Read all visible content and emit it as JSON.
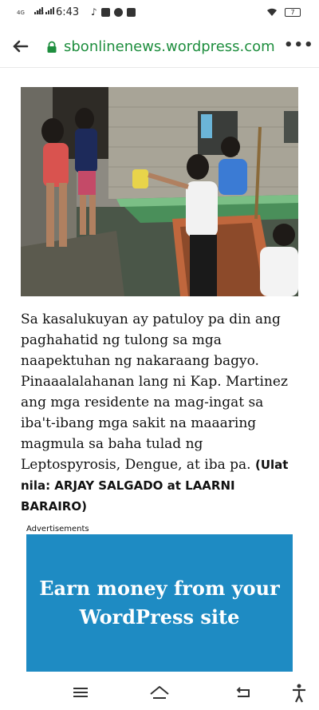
{
  "status_bar": {
    "signal1_label": "4G",
    "signal2_label": "3G",
    "time": "6:43",
    "notification_icons": [
      "tiktok-icon",
      "facebook-icon",
      "messenger-icon",
      "app-icon"
    ],
    "wifi_icon": "wifi-icon",
    "battery_level": "7"
  },
  "browser": {
    "url": "sbonlinenews.wordpress.com"
  },
  "article": {
    "body": "Sa kasalukuyan ay patuloy pa din ang paghahatid ng tulong sa mga naapektuhan ng nakaraang bagyo. Pinaaalalahanan lang ni Kap. Martinez ang mga residente na mag-ingat sa iba't-ibang mga sakit na maaaring magmula sa baha tulad ng Leptospyrosis, Dengue, at iba pa.",
    "credit": "(Ulat nila: ARJAY SALGADO at LAARNI BARAIRO)"
  },
  "ads": {
    "label": "Advertisements",
    "banner_text": "Earn money from your WordPress site",
    "banner_color": "#1e8bc3"
  },
  "colors": {
    "url_green": "#1e8e3e"
  }
}
